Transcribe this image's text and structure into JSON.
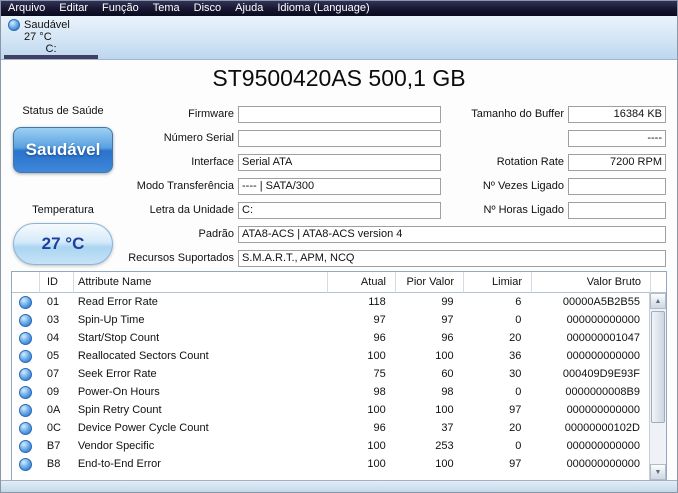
{
  "menu": {
    "items": [
      "Arquivo",
      "Editar",
      "Função",
      "Tema",
      "Disco",
      "Ajuda",
      "Idioma (Language)"
    ]
  },
  "disk_tab": {
    "status": "Saudável",
    "temperature": "27 °C",
    "drive_letter": "C:"
  },
  "drive": {
    "title": "ST9500420AS 500,1 GB"
  },
  "health": {
    "label": "Status de Saúde",
    "status": "Saudável"
  },
  "temperature": {
    "label": "Temperatura",
    "value": "27 °C"
  },
  "info_fields": {
    "firmware": {
      "label": "Firmware",
      "value": ""
    },
    "serial_number": {
      "label": "Número Serial",
      "value": ""
    },
    "interface": {
      "label": "Interface",
      "value": "Serial ATA"
    },
    "transfer_mode": {
      "label": "Modo Transferência",
      "value": "---- | SATA/300"
    },
    "drive_letter": {
      "label": "Letra da Unidade",
      "value": "C:"
    },
    "standard": {
      "label": "Padrão",
      "value": "ATA8-ACS | ATA8-ACS version 4"
    },
    "supported_features": {
      "label": "Recursos Suportados",
      "value": "S.M.A.R.T., APM, NCQ"
    },
    "buffer_size": {
      "label": "Tamanho do Buffer",
      "value": "16384 KB"
    },
    "unlabeled": {
      "label": "",
      "value": "----"
    },
    "rotation_rate": {
      "label": "Rotation Rate",
      "value": "7200 RPM"
    },
    "power_on_count": {
      "label": "Nº Vezes Ligado",
      "value": ""
    },
    "power_on_hours": {
      "label": "Nº Horas Ligado",
      "value": ""
    }
  },
  "smart_table": {
    "headers": {
      "id": "ID",
      "name": "Attribute Name",
      "current": "Atual",
      "worst": "Pior Valor",
      "threshold": "Limiar",
      "raw": "Valor Bruto"
    },
    "rows": [
      {
        "id": "01",
        "name": "Read Error Rate",
        "current": "118",
        "worst": "99",
        "threshold": "6",
        "raw": "00000A5B2B55"
      },
      {
        "id": "03",
        "name": "Spin-Up Time",
        "current": "97",
        "worst": "97",
        "threshold": "0",
        "raw": "000000000000"
      },
      {
        "id": "04",
        "name": "Start/Stop Count",
        "current": "96",
        "worst": "96",
        "threshold": "20",
        "raw": "000000001047"
      },
      {
        "id": "05",
        "name": "Reallocated Sectors Count",
        "current": "100",
        "worst": "100",
        "threshold": "36",
        "raw": "000000000000"
      },
      {
        "id": "07",
        "name": "Seek Error Rate",
        "current": "75",
        "worst": "60",
        "threshold": "30",
        "raw": "000409D9E93F"
      },
      {
        "id": "09",
        "name": "Power-On Hours",
        "current": "98",
        "worst": "98",
        "threshold": "0",
        "raw": "0000000008B9"
      },
      {
        "id": "0A",
        "name": "Spin Retry Count",
        "current": "100",
        "worst": "100",
        "threshold": "97",
        "raw": "000000000000"
      },
      {
        "id": "0C",
        "name": "Device Power Cycle Count",
        "current": "96",
        "worst": "37",
        "threshold": "20",
        "raw": "00000000102D"
      },
      {
        "id": "B7",
        "name": "Vendor Specific",
        "current": "100",
        "worst": "253",
        "threshold": "0",
        "raw": "000000000000"
      },
      {
        "id": "B8",
        "name": "End-to-End Error",
        "current": "100",
        "worst": "100",
        "threshold": "97",
        "raw": "000000000000"
      }
    ]
  },
  "icons": {
    "scroll_up": "▲",
    "scroll_down": "▼"
  },
  "colors": {
    "menu_bg": "#14142c",
    "disk_bar_top": "#eaf3fb",
    "disk_bar_bottom": "#bdd7ee",
    "tab_indicator": "#413f63",
    "health_badge_top": "#9dd0f2",
    "health_badge_bottom": "#2a72cc",
    "temp_text": "#1c3f9d",
    "orb_blue": "#1e66c0",
    "field_border": "#a0a0a0",
    "table_border": "#93a8be"
  }
}
